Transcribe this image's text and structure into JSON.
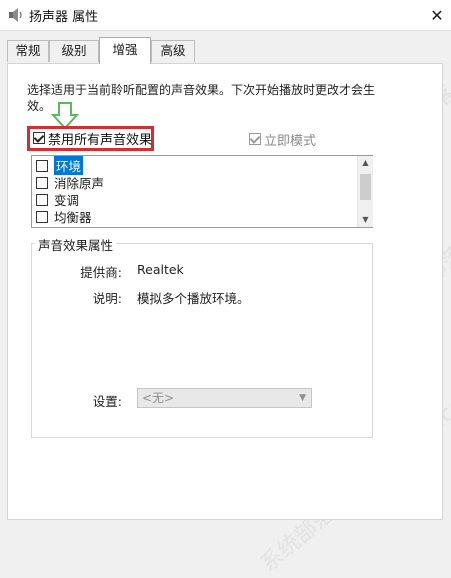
{
  "window": {
    "title": "扬声器 属性",
    "close_glyph": "✕"
  },
  "tabs": [
    {
      "label": "常规",
      "active": false
    },
    {
      "label": "级别",
      "active": false
    },
    {
      "label": "增强",
      "active": true
    },
    {
      "label": "高级",
      "active": false
    }
  ],
  "description": "选择适用于当前聆听配置的声音效果。下次开始播放时更改才会生效。",
  "disable_all": {
    "label": "禁用所有声音效果",
    "checked": true
  },
  "immediate_mode": {
    "label": "立即模式",
    "checked": true,
    "disabled": true
  },
  "effects": [
    {
      "label": "环境",
      "checked": false,
      "selected": true
    },
    {
      "label": "消除原声",
      "checked": false,
      "selected": false
    },
    {
      "label": "变调",
      "checked": false,
      "selected": false
    },
    {
      "label": "均衡器",
      "checked": false,
      "selected": false
    }
  ],
  "properties": {
    "group_title": "声音效果属性",
    "provider_label": "提供商:",
    "provider_value": "Realtek",
    "desc_label": "说明:",
    "desc_value": "模拟多个播放环境。",
    "settings_label": "设置:",
    "settings_value": "<无>"
  },
  "watermark": "系统部落 xitongbuluo.com",
  "colors": {
    "highlight_border": "#d32f2f",
    "arrow_green": "#5cb85c",
    "selection": "#0078d7"
  }
}
